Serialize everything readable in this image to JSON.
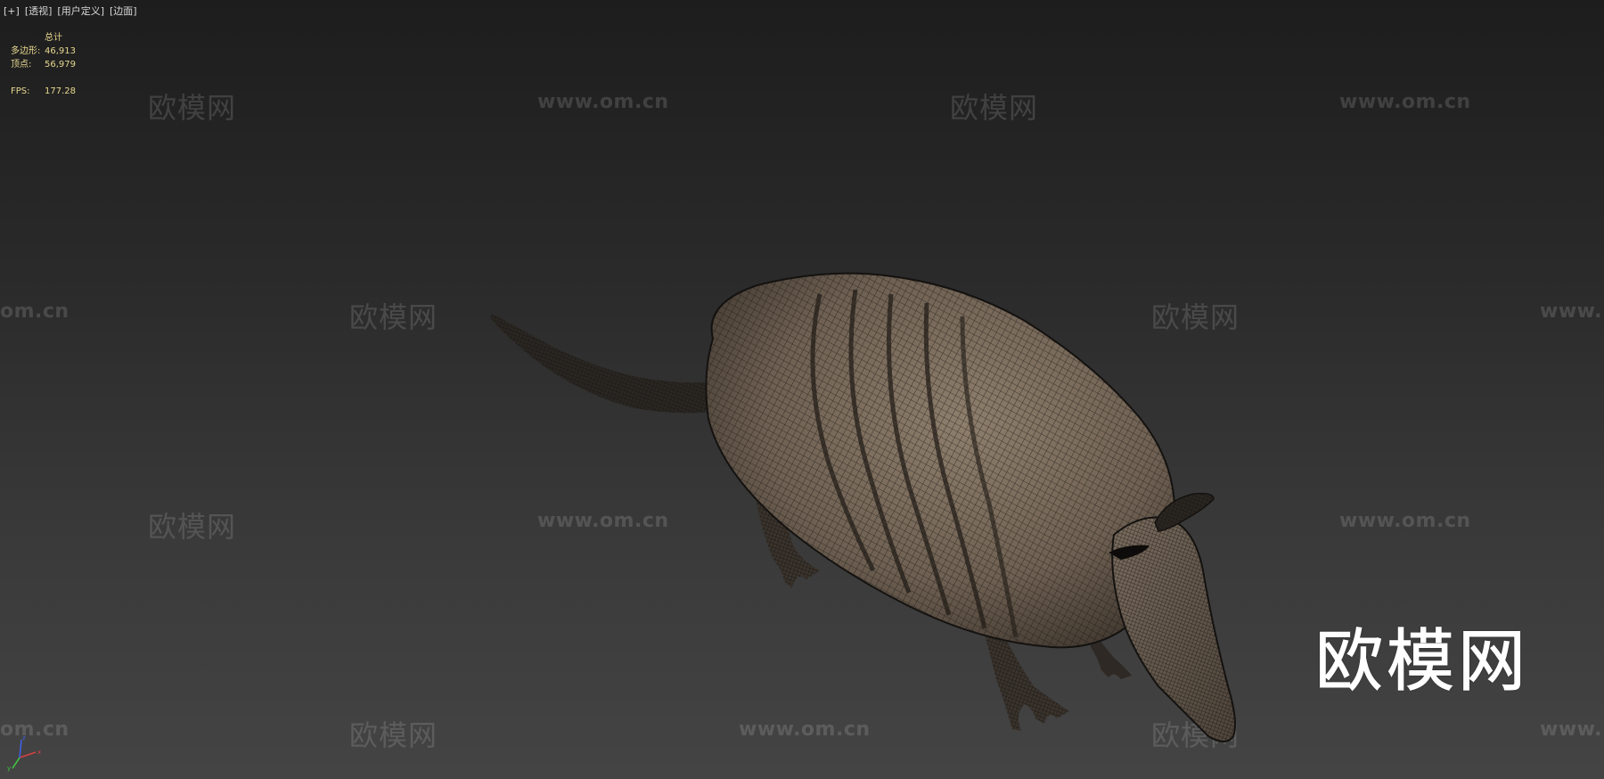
{
  "viewport_menu": {
    "plus": "[+]",
    "view": "[透视]",
    "shading": "[用户定义]",
    "edges": "[边面]"
  },
  "stats": {
    "header": "总计",
    "polygons_label": "多边形:",
    "polygons_value": "46,913",
    "vertices_label": "顶点:",
    "vertices_value": "56,979",
    "fps_label": "FPS:",
    "fps_value": "177.28"
  },
  "watermarks": {
    "logo_text": "欧模网",
    "url_text": "www.om.cn",
    "url_partial_left": "om.cn",
    "url_partial_right": "www."
  },
  "brand_logo": "欧模网",
  "model": {
    "name": "armadillo-mesh",
    "shell_color": "#7a6a5a",
    "wire_color": "#1a1612"
  },
  "axis_gizmo": {
    "x_color": "#d84040",
    "y_color": "#40c040",
    "z_color": "#4060e0"
  }
}
